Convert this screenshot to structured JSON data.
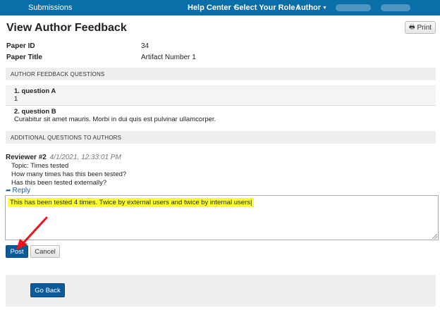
{
  "nav": {
    "submissions": "Submissions",
    "help_center": "Help Center",
    "select_role": "Select Your Role :",
    "role": "Author"
  },
  "page": {
    "title": "View Author Feedback",
    "print_label": "Print"
  },
  "paper": {
    "id_label": "Paper ID",
    "id_value": "34",
    "title_label": "Paper Title",
    "title_value": "Artifact Number 1"
  },
  "feedback": {
    "heading": "AUTHOR FEEDBACK QUESTIONS",
    "questions": [
      {
        "question": "1. question A",
        "answer": "1"
      },
      {
        "question": "2. question B",
        "answer": "Curabitur sit amet mauris. Morbi in dui quis est pulvinar ullamcorper."
      }
    ]
  },
  "additional": {
    "heading": "ADDITIONAL QUESTIONS TO AUTHORS",
    "reviewer": "Reviewer #2",
    "date": "4/1/2021, 12:33:01 PM",
    "lines": [
      "Topic: Times tested",
      "How many times has this been tested?",
      "Has this been tested externally?"
    ],
    "reply_label": "Reply",
    "reply_text": "This has been tested 4 times.  Twice by external users and twice by internal users|"
  },
  "actions": {
    "post": "Post",
    "cancel": "Cancel",
    "go_back": "Go Back"
  },
  "colors": {
    "nav_bg": "#0a6ea8",
    "primary_button": "#0b5a99",
    "highlight": "#ffff33",
    "annotation_arrow": "#e8141c"
  }
}
